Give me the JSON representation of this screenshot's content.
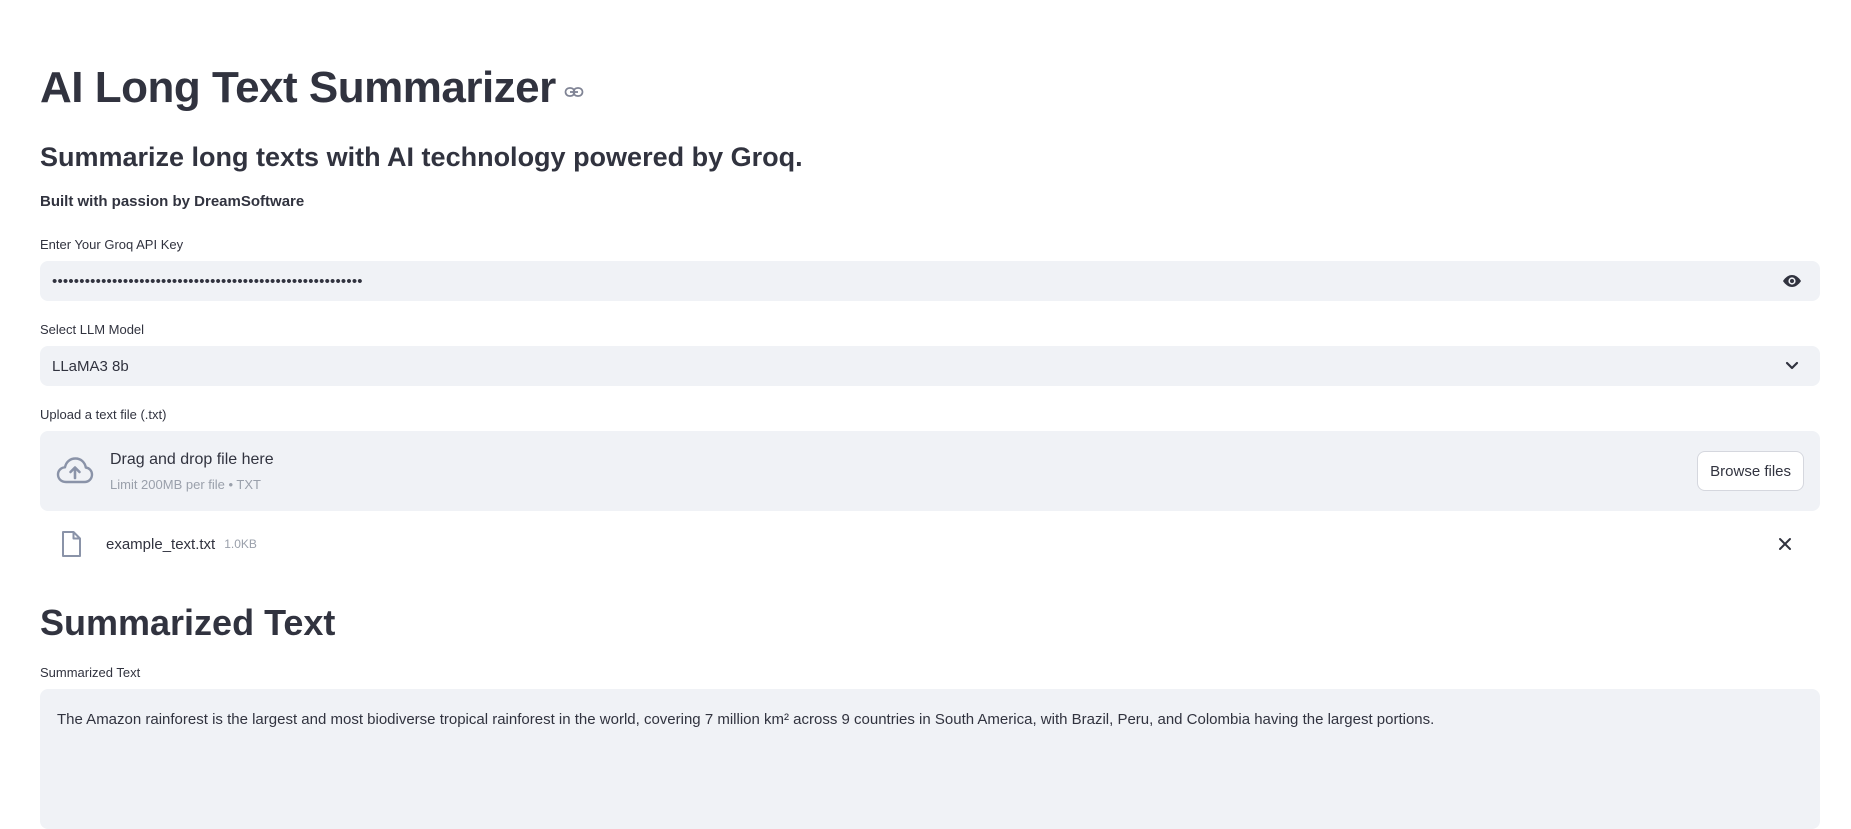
{
  "header": {
    "title": "AI Long Text Summarizer",
    "subtitle": "Summarize long texts with AI technology powered by Groq.",
    "credit": "Built with passion by DreamSoftware"
  },
  "api_key": {
    "label": "Enter Your Groq API Key",
    "masked_value": "•••••••••••••••••••••••••••••••••••••••••••••••••••••••••",
    "toggle_icon": "eye-icon"
  },
  "model_select": {
    "label": "Select LLM Model",
    "selected": "LLaMA3 8b",
    "icon": "chevron-down-icon"
  },
  "uploader": {
    "label": "Upload a text file (.txt)",
    "drop_title": "Drag and drop file here",
    "drop_subtitle": "Limit 200MB per file • TXT",
    "browse_label": "Browse files",
    "icon": "cloud-upload-icon"
  },
  "uploaded_file": {
    "name": "example_text.txt",
    "size": "1.0KB",
    "icon": "file-icon"
  },
  "result": {
    "section_title": "Summarized Text",
    "field_label": "Summarized Text",
    "text": "The Amazon rainforest is the largest and most biodiverse tropical rainforest in the world, covering 7 million km² across 9 countries in South America, with Brazil, Peru, and Colombia having the largest portions."
  },
  "colors": {
    "text": "#31333f",
    "field_bg": "#f0f2f6",
    "muted": "#9aa0ab",
    "icon": "#808495"
  }
}
